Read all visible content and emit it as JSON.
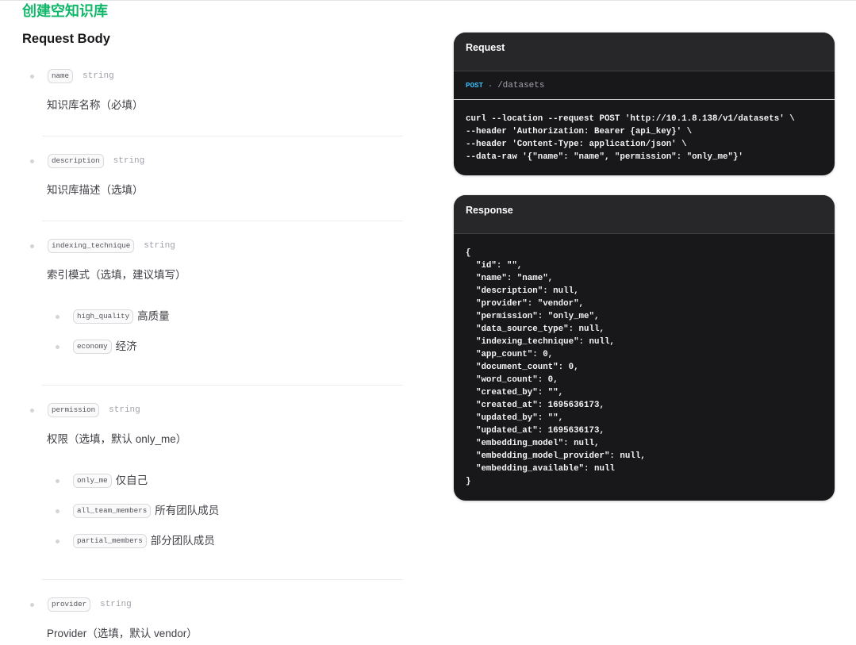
{
  "theme": {
    "accent": "#12b76a",
    "method": "#38bdf8",
    "code_background": "#18181b",
    "code_header_background": "#27272a"
  },
  "page": {
    "title": "创建空知识库",
    "section_heading": "Request Body"
  },
  "request_body": {
    "params": [
      {
        "name": "name",
        "type": "string",
        "description": "知识库名称（必填）"
      },
      {
        "name": "description",
        "type": "string",
        "description": "知识库描述（选填）"
      },
      {
        "name": "indexing_technique",
        "type": "string",
        "description": "索引模式（选填，建议填写）",
        "options": [
          {
            "value": "high_quality",
            "label": "高质量"
          },
          {
            "value": "economy",
            "label": "经济"
          }
        ]
      },
      {
        "name": "permission",
        "type": "string",
        "description": "权限（选填，默认 only_me）",
        "options": [
          {
            "value": "only_me",
            "label": "仅自己"
          },
          {
            "value": "all_team_members",
            "label": "所有团队成员"
          },
          {
            "value": "partial_members",
            "label": "部分团队成员"
          }
        ]
      },
      {
        "name": "provider",
        "type": "string",
        "description": "Provider（选填，默认 vendor）"
      }
    ]
  },
  "request_panel": {
    "title": "Request",
    "method": "POST",
    "path": "/datasets",
    "code_lines": [
      "curl --location --request POST 'http://10.1.8.138/v1/datasets' \\",
      "--header 'Authorization: Bearer {api_key}' \\",
      "--header 'Content-Type: application/json' \\",
      "--data-raw '{\"name\": \"name\", \"permission\": \"only_me\"}'"
    ]
  },
  "response_panel": {
    "title": "Response",
    "code_lines": [
      "{",
      "  \"id\": \"\",",
      "  \"name\": \"name\",",
      "  \"description\": null,",
      "  \"provider\": \"vendor\",",
      "  \"permission\": \"only_me\",",
      "  \"data_source_type\": null,",
      "  \"indexing_technique\": null,",
      "  \"app_count\": 0,",
      "  \"document_count\": 0,",
      "  \"word_count\": 0,",
      "  \"created_by\": \"\",",
      "  \"created_at\": 1695636173,",
      "  \"updated_by\": \"\",",
      "  \"updated_at\": 1695636173,",
      "  \"embedding_model\": null,",
      "  \"embedding_model_provider\": null,",
      "  \"embedding_available\": null",
      "}"
    ]
  }
}
